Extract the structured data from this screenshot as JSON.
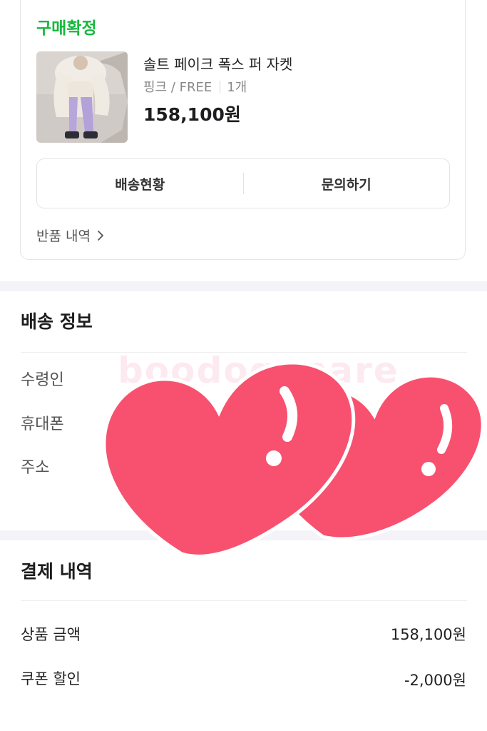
{
  "order": {
    "status": "구매확정",
    "product": {
      "name": "솔트 페이크 폭스 퍼 자켓",
      "option": "핑크 / FREE",
      "quantity": "1개",
      "price": "158,100원"
    },
    "buttons": {
      "tracking": "배송현황",
      "inquiry": "문의하기"
    },
    "return_link": "반품 내역"
  },
  "shipping": {
    "title": "배송 정보",
    "labels": {
      "recipient": "수령인",
      "phone": "휴대폰",
      "address": "주소"
    }
  },
  "payment": {
    "title": "결제 내역",
    "rows": [
      {
        "label": "상품 금액",
        "value": "158,100원"
      },
      {
        "label": "쿠폰 할인",
        "value": "-2,000원"
      }
    ]
  },
  "overlay": {
    "watermark": "boodogonare",
    "sticker": "hearts-sticker"
  },
  "colors": {
    "status_green": "#15b83c",
    "heart_pink": "#f7516f",
    "section_band": "#f3f3f8"
  }
}
